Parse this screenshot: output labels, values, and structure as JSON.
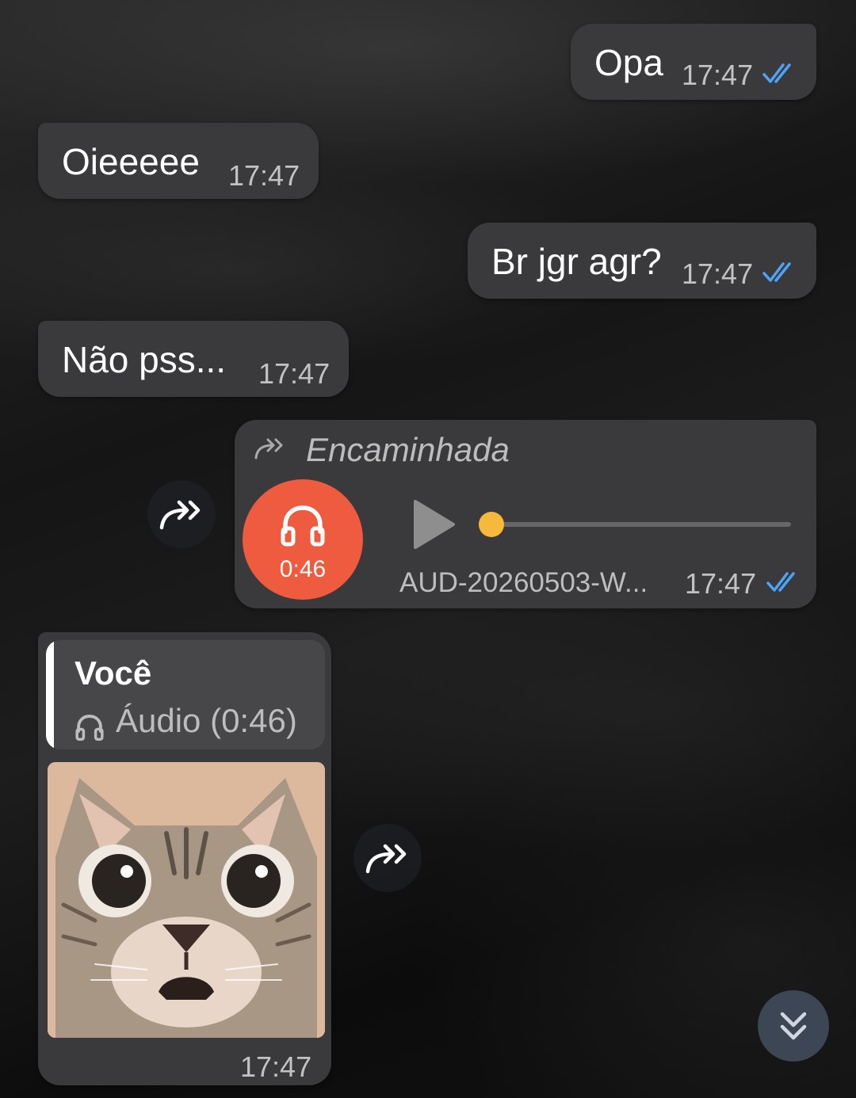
{
  "messages": {
    "m1": {
      "text": "Opa",
      "time": "17:47"
    },
    "m2": {
      "text": "Oieeeee",
      "time": "17:47"
    },
    "m3": {
      "text": "Br jgr agr?",
      "time": "17:47"
    },
    "m4": {
      "text": "Não pss...",
      "time": "17:47"
    },
    "audio": {
      "forwarded_label": "Encaminhada",
      "duration": "0:46",
      "filename": "AUD-20260503-W...",
      "time": "17:47",
      "progress": 0
    },
    "reply": {
      "author": "Você",
      "quoted": "Áudio (0:46)",
      "time": "17:47"
    }
  },
  "icons": {
    "read_receipt": "double-check-icon",
    "forward": "forward-arrow-icon",
    "headphones": "headphones-icon",
    "play": "play-icon",
    "scroll_down": "double-chevron-down-icon"
  },
  "colors": {
    "bubble": "#3a3a3c",
    "tick": "#4fa3f7",
    "audio_button": "#ee5b3e",
    "seek_dot": "#f6b93b",
    "reply_bar": "#ffffff"
  }
}
